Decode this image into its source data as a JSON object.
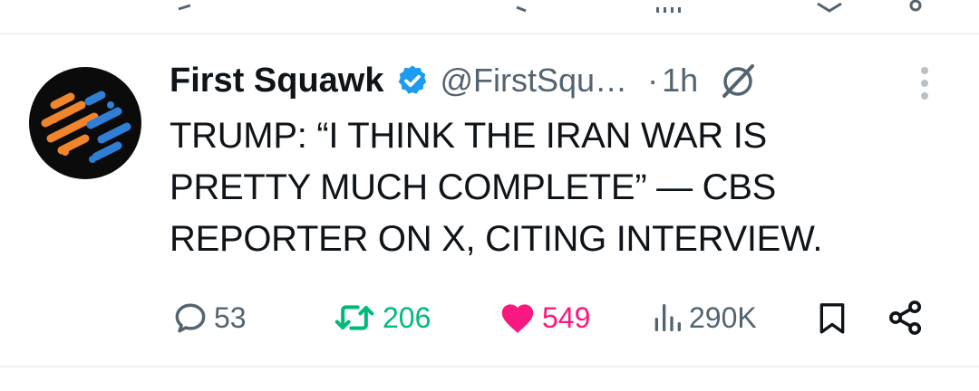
{
  "tweet": {
    "author_name": "First Squawk",
    "handle": "@FirstSqu…",
    "separator": "·",
    "time": "1h",
    "text": "TRUMP: “I THINK THE IRAN WAR IS PRETTY MUCH COMPLETE” — CBS REPORTER ON X, CITING INTERVIEW.",
    "verified": true
  },
  "actions": {
    "replies": "53",
    "reposts": "206",
    "likes": "549",
    "views": "290K",
    "liked": true
  },
  "icons": {
    "verified": "verified-badge-icon",
    "grok": "grok-icon",
    "more": "more-vertical-icon",
    "reply": "reply-icon",
    "repost": "repost-icon",
    "like": "heart-icon",
    "views": "views-icon",
    "bookmark": "bookmark-icon",
    "share": "share-icon"
  },
  "colors": {
    "primary_text": "#0f1419",
    "secondary_text": "#536471",
    "verified_blue": "#1d9bf0",
    "repost_green": "#00ba7c",
    "like_pink": "#f91880",
    "avatar_orange": "#f0852c",
    "avatar_blue": "#2f7fd6"
  }
}
